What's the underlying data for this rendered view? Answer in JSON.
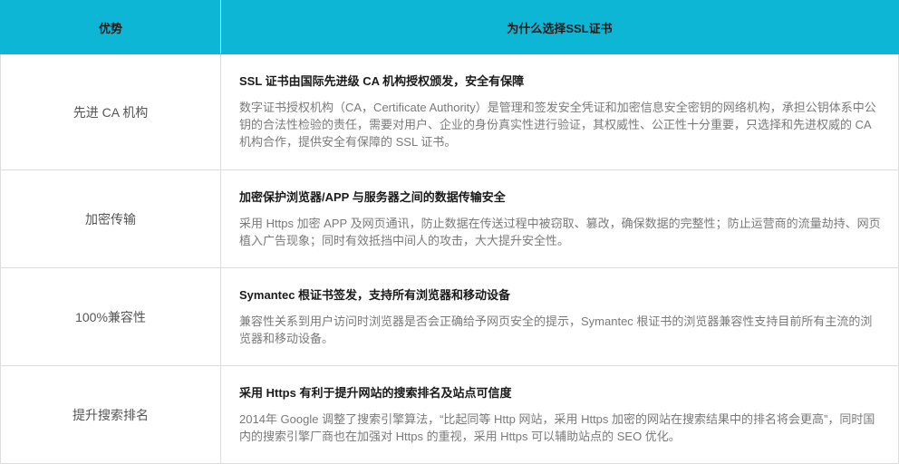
{
  "header": {
    "col_advantage": "优势",
    "col_reason": "为什么选择SSL证书"
  },
  "rows": [
    {
      "advantage": "先进 CA 机构",
      "title": "SSL 证书由国际先进级 CA 机构授权颁发，安全有保障",
      "body": "数字证书授权机构（CA，Certificate Authority）是管理和签发安全凭证和加密信息安全密钥的网络机构，承担公钥体系中公钥的合法性检验的责任，需要对用户、企业的身份真实性进行验证，其权威性、公正性十分重要，只选择和先进权威的 CA 机构合作，提供安全有保障的 SSL 证书。"
    },
    {
      "advantage": "加密传输",
      "title": "加密保护浏览器/APP 与服务器之间的数据传输安全",
      "body": "采用 Https 加密 APP 及网页通讯，防止数据在传送过程中被窃取、篡改，确保数据的完整性；防止运营商的流量劫持、网页植入广告现象；同时有效抵挡中间人的攻击，大大提升安全性。"
    },
    {
      "advantage": "100%兼容性",
      "title": "Symantec 根证书签发，支持所有浏览器和移动设备",
      "body": "兼容性关系到用户访问时浏览器是否会正确给予网页安全的提示，Symantec 根证书的浏览器兼容性支持目前所有主流的浏览器和移动设备。"
    },
    {
      "advantage": "提升搜索排名",
      "title": "采用 Https 有利于提升网站的搜索排名及站点可信度",
      "body": "2014年 Google 调整了搜索引擎算法，“比起同等 Http 网站，采用 Https 加密的网站在搜索结果中的排名将会更高”，同时国内的搜索引擎厂商也在加强对 Https 的重视，采用 Https 可以辅助站点的 SEO 优化。"
    }
  ],
  "colors": {
    "header_bg": "#0eb6d6",
    "border": "#dcdcdc"
  }
}
